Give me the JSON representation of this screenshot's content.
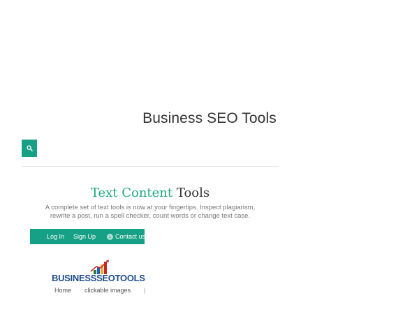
{
  "header": {
    "site_title": "Business SEO Tools"
  },
  "search": {
    "icon": "search-icon"
  },
  "section": {
    "title_accent": "Text Content",
    "title_rest": "Tools",
    "description": "A complete set of text tools is now at your fingertips. Inspect plagiarism, rewrite a post, run a spell checker, count words or change text case."
  },
  "nav": {
    "login": "Log In",
    "signup": "Sign Up",
    "contact": "Contact us",
    "contact_icon": "globe-icon"
  },
  "logo": {
    "part1": "BUSINESS",
    "part2": "SEO",
    "part3": "TOOLS"
  },
  "breadcrumbs": {
    "home": "Home",
    "images": "clickable images",
    "separator": "|"
  },
  "colors": {
    "accent": "#16a085",
    "accent_text": "#1eaa78",
    "logo_blue": "#1f4e8c"
  }
}
